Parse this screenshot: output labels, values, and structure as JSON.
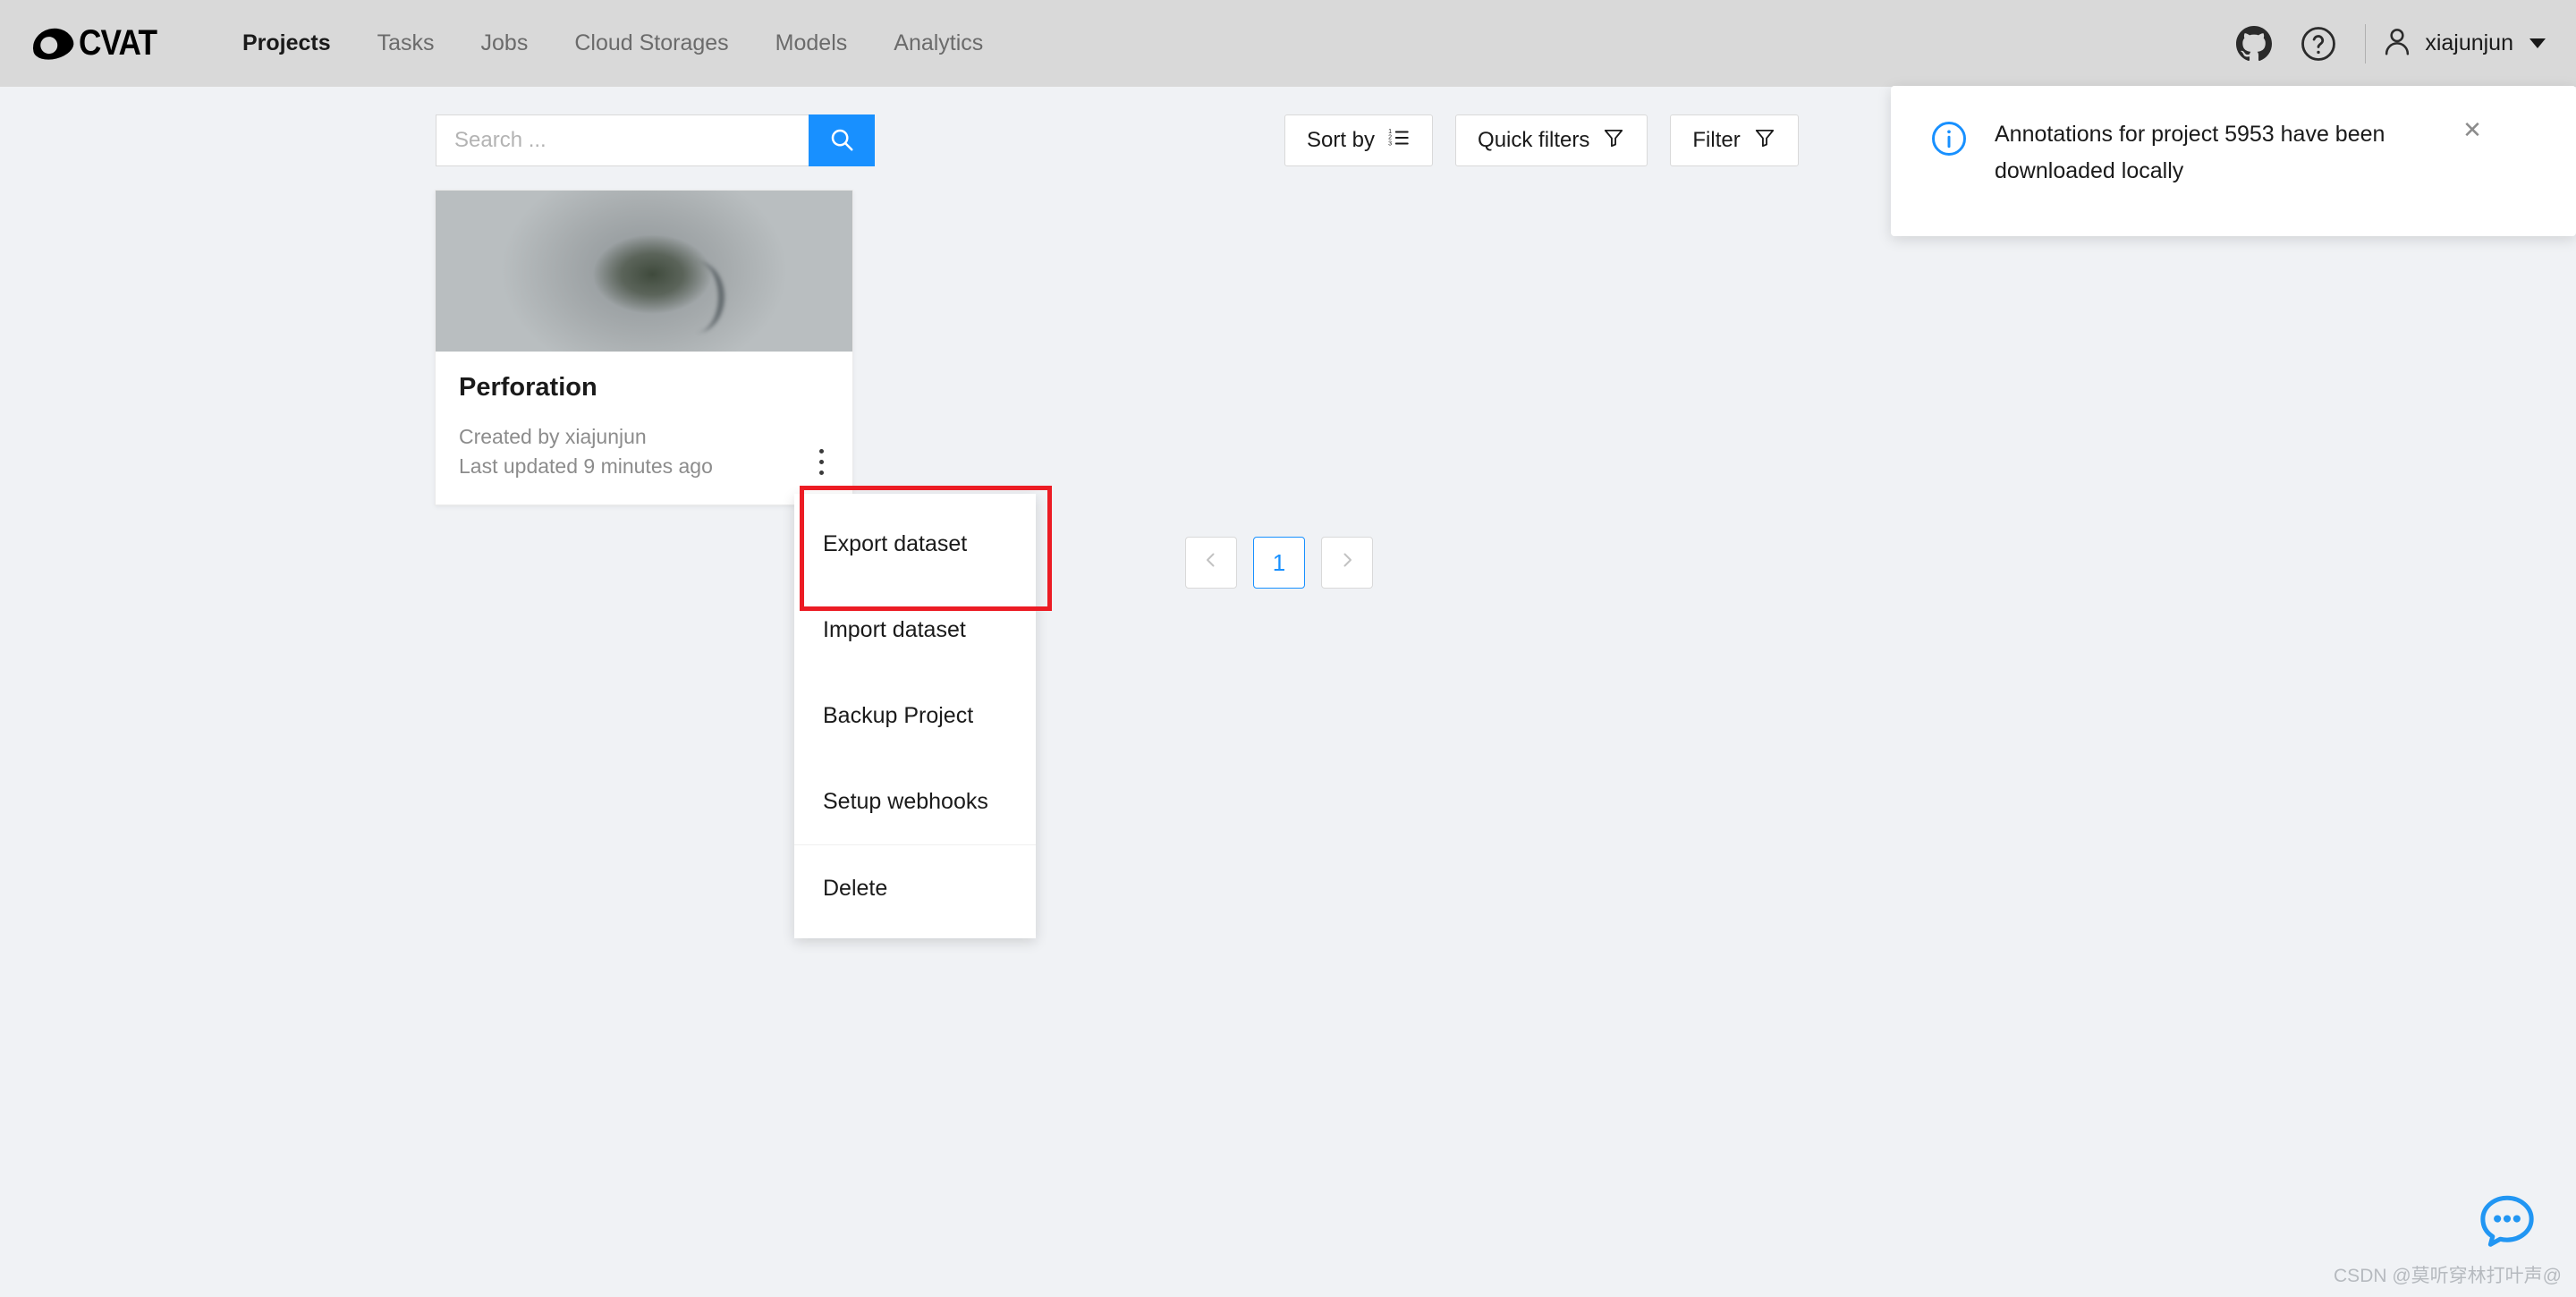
{
  "header": {
    "logo_text": "CVAT",
    "nav": [
      {
        "label": "Projects",
        "active": true
      },
      {
        "label": "Tasks",
        "active": false
      },
      {
        "label": "Jobs",
        "active": false
      },
      {
        "label": "Cloud Storages",
        "active": false
      },
      {
        "label": "Models",
        "active": false
      },
      {
        "label": "Analytics",
        "active": false
      }
    ],
    "github_icon": "github-icon",
    "help_icon": "question-circle-icon",
    "user_icon": "user-icon",
    "user_name": "xiajunjun",
    "caret_icon": "chevron-down-icon"
  },
  "toolbar": {
    "search_placeholder": "Search ...",
    "search_value": "",
    "search_icon": "search-icon",
    "sort_by_label": "Sort by",
    "sort_by_icon": "ordered-list-icon",
    "quick_filters_label": "Quick filters",
    "quick_filters_icon": "funnel-icon",
    "filter_label": "Filter",
    "filter_icon": "funnel-icon"
  },
  "project_card": {
    "title": "Perforation",
    "created_by": "Created by xiajunjun",
    "last_updated": "Last updated 9 minutes ago",
    "menu_icon": "more-vertical-icon",
    "thumbnail_alt": "endoscopy-thumbnail"
  },
  "context_menu": {
    "items": [
      {
        "label": "Export dataset",
        "highlighted": true
      },
      {
        "label": "Import dataset",
        "highlighted": false
      },
      {
        "label": "Backup Project",
        "highlighted": false
      },
      {
        "label": "Setup webhooks",
        "highlighted": false
      }
    ],
    "danger_item": {
      "label": "Delete"
    }
  },
  "pagination": {
    "prev_icon": "chevron-left-icon",
    "current_page": "1",
    "next_icon": "chevron-right-icon"
  },
  "notification": {
    "icon": "info-circle-icon",
    "message": "Annotations for project 5953 have been downloaded locally",
    "close_label": "✕"
  },
  "chat": {
    "icon": "chat-bubble-icon"
  },
  "watermark": {
    "text": "CSDN @莫听穿林打叶声@"
  },
  "colors": {
    "accent_blue": "#1890ff",
    "header_bg": "#d9d9d9",
    "page_bg": "#f0f2f5",
    "highlight_red": "#ec1c24"
  }
}
